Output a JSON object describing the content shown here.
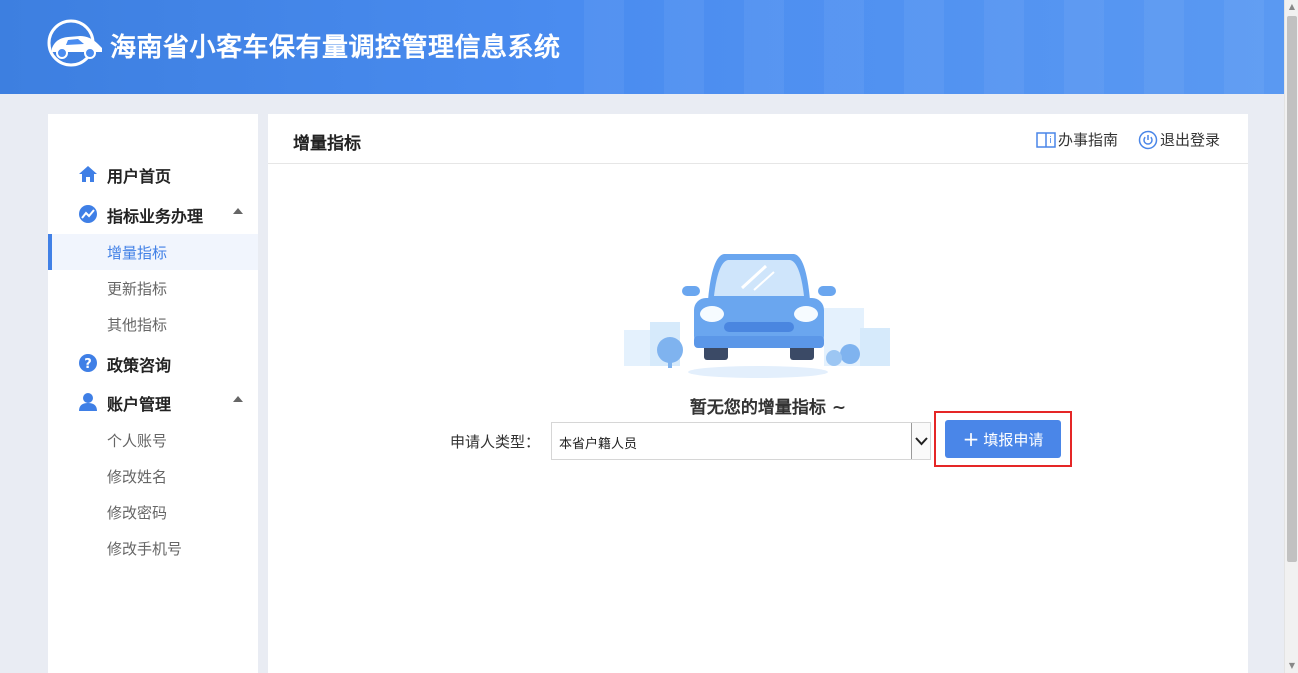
{
  "header": {
    "title": "海南省小客车保有量调控管理信息系统",
    "logo_icon": "car-logo-icon"
  },
  "sidebar": {
    "groups": [
      {
        "label": "用户首页",
        "icon": "home-icon"
      },
      {
        "label": "指标业务办理",
        "icon": "chart-trend-icon",
        "expanded": true,
        "items": [
          {
            "label": "增量指标",
            "active": true
          },
          {
            "label": "更新指标"
          },
          {
            "label": "其他指标"
          }
        ]
      },
      {
        "label": "政策咨询",
        "icon": "question-icon"
      },
      {
        "label": "账户管理",
        "icon": "user-icon",
        "expanded": true,
        "items": [
          {
            "label": "个人账号"
          },
          {
            "label": "修改姓名"
          },
          {
            "label": "修改密码"
          },
          {
            "label": "修改手机号"
          }
        ]
      }
    ]
  },
  "main": {
    "title": "增量指标",
    "guide_link": "办事指南",
    "logout_link": "退出登录",
    "empty_text": "暂无您的增量指标 ~",
    "applicant_label": "申请人类型：",
    "applicant_select_value": "本省户籍人员",
    "apply_button": "填报申请",
    "apply_button_icon": "plus-icon"
  },
  "colors": {
    "primary": "#4a86e8",
    "header_bg": "#4a8cf0",
    "highlight": "#e52626"
  }
}
